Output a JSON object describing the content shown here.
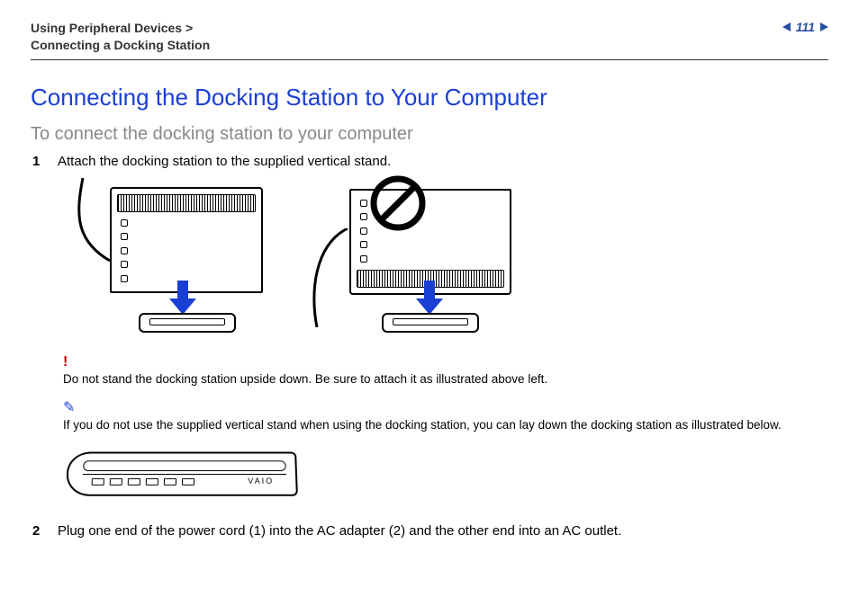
{
  "breadcrumb": {
    "line1": "Using Peripheral Devices >",
    "line2": "Connecting a Docking Station"
  },
  "page_number": "111",
  "title": "Connecting the Docking Station to Your Computer",
  "subtitle": "To connect the docking station to your computer",
  "steps": {
    "s1": {
      "num": "1",
      "text": "Attach the docking station to the supplied vertical stand."
    },
    "s2": {
      "num": "2",
      "text": "Plug one end of the power cord (1) into the AC adapter (2) and the other end into an AC outlet."
    }
  },
  "notes": {
    "warning_mark": "!",
    "warning_text": "Do not stand the docking station upside down. Be sure to attach it as illustrated above left.",
    "tip_mark": "✎",
    "tip_text": "If you do not use the supplied vertical stand when using the docking station, you can lay down the docking station as illustrated below."
  },
  "brand": "VAIO"
}
